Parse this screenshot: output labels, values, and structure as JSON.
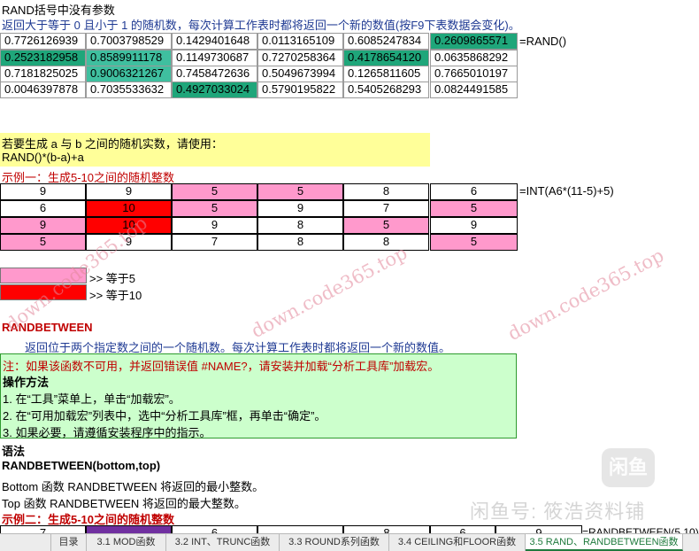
{
  "colors": {
    "teal": "#1fa67a",
    "teal_light": "#3fbf9f",
    "pink": "#ff99cc",
    "red": "#ff0000",
    "yellow": "#ffff99",
    "green_note": "#ccffcc",
    "dark_red": "#c00000",
    "purple": "#7030a0"
  },
  "header": {
    "line1": "RAND括号中没有参数",
    "line2": "返回大于等于 0 且小于 1 的随机数，每次计算工作表时都将返回一个新的数值(按F9下表数据会变化)。"
  },
  "rand_table": {
    "rows": [
      [
        "0.7726126939",
        "0.7003798529",
        "0.1429401648",
        "0.0113165109",
        "0.6085247834",
        "0.2609865571"
      ],
      [
        "0.2523182958",
        "0.8589911178",
        "0.1149730687",
        "0.7270258364",
        "0.4178654120",
        "0.0635868292"
      ],
      [
        "0.7181825025",
        "0.9006321267",
        "0.7458472636",
        "0.5049673994",
        "0.1265811605",
        "0.7665010197"
      ],
      [
        "0.0046397878",
        "0.7035533632",
        "0.4927033024",
        "0.5790195822",
        "0.5405268293",
        "0.0824491585"
      ]
    ],
    "formula": "=RAND()"
  },
  "yellow_box": {
    "line1": "若要生成 a 与 b 之间的随机实数，请使用：",
    "line2": "RAND()*(b-a)+a"
  },
  "example1_title": "示例一：生成5-10之间的随机整数",
  "int_table": {
    "rows": [
      [
        "9",
        "9",
        "5",
        "5",
        "8",
        "6"
      ],
      [
        "6",
        "10",
        "5",
        "9",
        "7",
        "5"
      ],
      [
        "9",
        "10",
        "9",
        "8",
        "5",
        "9"
      ],
      [
        "5",
        "9",
        "7",
        "8",
        "8",
        "5"
      ]
    ],
    "formula": "=INT(A6*(11-5)+5)"
  },
  "legend": {
    "eq5": ">> 等于5",
    "eq10": ">> 等于10"
  },
  "randbetween": {
    "title": "RANDBETWEEN",
    "desc": "返回位于两个指定数之间的一个随机数。每次计算工作表时都将返回一个新的数值。",
    "note": "注：如果该函数不可用，并返回错误值 #NAME?，请安装并加载“分析工具库”加载宏。",
    "steps_title": "操作方法",
    "steps": [
      "1. 在“工具”菜单上，单击“加载宏”。",
      "2. 在“可用加载宏”列表中，选中“分析工具库”框，再单击“确定”。",
      "3. 如果必要，请遵循安装程序中的指示。"
    ],
    "syntax_title": "语法",
    "syntax_fn": "RANDBETWEEN(",
    "syntax_p1": "bottom",
    "syntax_comma": ",",
    "syntax_p2": "top",
    "syntax_close": ")",
    "bottom_desc": "Bottom 函数 RANDBETWEEN 将返回的最小整数。",
    "top_desc": "Top 函数 RANDBETWEEN 将返回的最大整数。",
    "example2_title": "示例二：生成5-10之间的随机整数",
    "partial_row": [
      "7",
      "",
      "6",
      "",
      "8",
      "6",
      "9"
    ],
    "partial_formula": "=RANDBETWEEN(5,10)"
  },
  "watermarks": {
    "text": "down.code365.top",
    "overlay_logo": "闲鱼",
    "overlay_text": "闲鱼号: 筱浩资料铺"
  },
  "sheet_tabs": [
    "目录",
    "3.1 MOD函数",
    "3.2 INT、TRUNC函数",
    "3.3 ROUND系列函数",
    "3.4 CEILING和FLOOR函数",
    "3.5 RAND、RANDBETWEEN函数"
  ]
}
